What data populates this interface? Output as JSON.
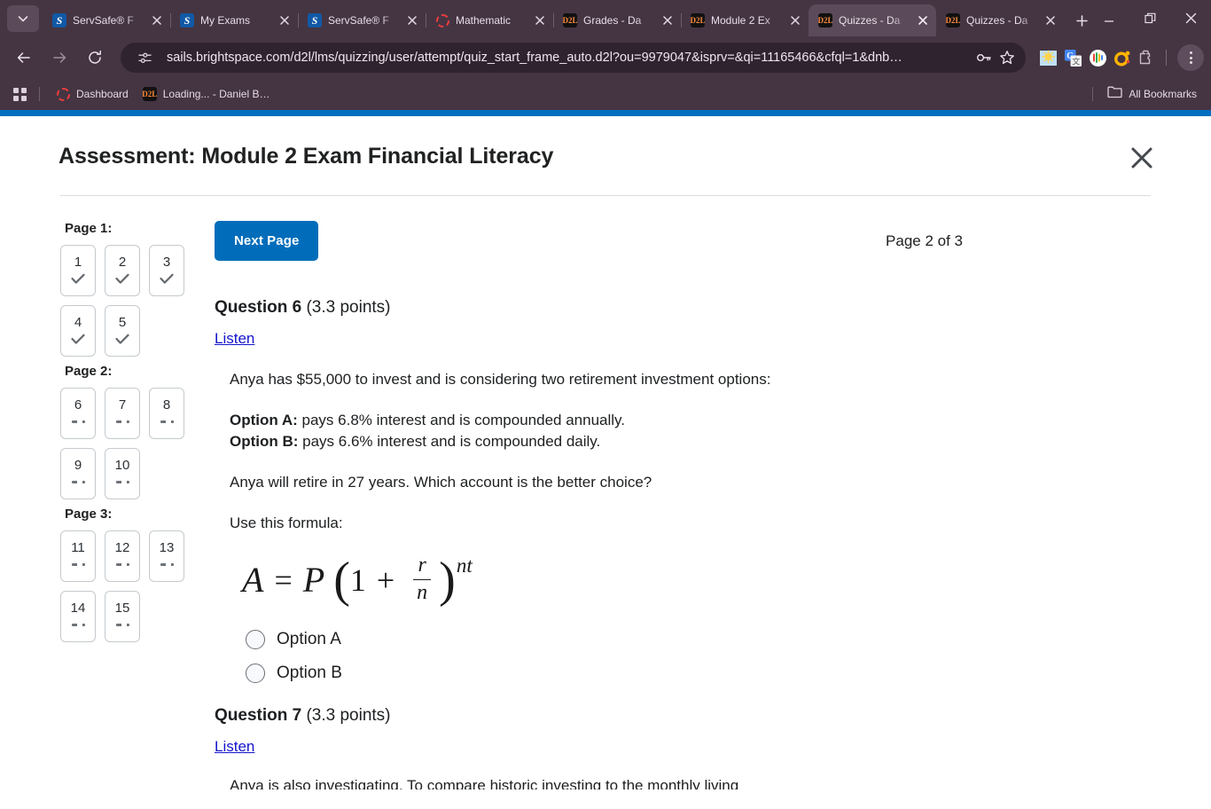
{
  "browser": {
    "tabs": [
      {
        "title": "ServSafe® F",
        "favicon": "servsafe-icon",
        "active": false
      },
      {
        "title": "My Exams",
        "favicon": "servsafe-icon",
        "active": false
      },
      {
        "title": "ServSafe® F",
        "favicon": "servsafe-icon",
        "active": false
      },
      {
        "title": "Mathematic",
        "favicon": "ring-icon",
        "active": false
      },
      {
        "title": "Grades - Da",
        "favicon": "d2l-icon",
        "active": false
      },
      {
        "title": "Module 2 Ex",
        "favicon": "d2l-icon",
        "active": false
      },
      {
        "title": "Quizzes - Da",
        "favicon": "d2l-icon",
        "active": true
      },
      {
        "title": "Quizzes - Da",
        "favicon": "d2l-icon",
        "active": false
      }
    ],
    "new_tab_label": "+",
    "window_controls": [
      "minimize-icon",
      "restore-icon",
      "close-icon"
    ],
    "nav": {
      "back": "back-arrow-icon",
      "forward": "forward-arrow-icon",
      "reload": "reload-icon"
    },
    "omnibox": {
      "site_info_icon": "site-settings-icon",
      "url": "sails.brightspace.com/d2l/lms/quizzing/user/attempt/quiz_start_frame_auto.d2l?ou=9979047&isprv=&qi=11165466&cfql=1&dnb…",
      "password_icon": "key-icon",
      "bookmark_icon": "star-icon"
    },
    "extensions": [
      "weather-extension-icon",
      "google-translate-icon",
      "colorful-circle-extension-icon",
      "orange-o-extension-icon",
      "puzzle-extensions-icon"
    ],
    "menu_icon": "kebab-menu-icon",
    "bookmarks": {
      "apps_icon": "apps-grid-icon",
      "items": [
        {
          "label": "Dashboard",
          "favicon": "ring-icon"
        },
        {
          "label": "Loading... - Daniel B…",
          "favicon": "d2l-icon"
        }
      ],
      "all_bookmarks_label": "All Bookmarks",
      "all_bookmarks_icon": "folder-icon"
    },
    "accent_color": "#006fbf",
    "chrome_color": "#453543"
  },
  "assessment": {
    "title": "Assessment: Module 2 Exam Financial Literacy",
    "close_icon": "close-icon",
    "navigator": {
      "groups": [
        {
          "label": "Page 1:",
          "questions": [
            {
              "num": "1",
              "state": "answered"
            },
            {
              "num": "2",
              "state": "answered"
            },
            {
              "num": "3",
              "state": "answered"
            },
            {
              "num": "4",
              "state": "answered"
            },
            {
              "num": "5",
              "state": "answered"
            }
          ]
        },
        {
          "label": "Page 2:",
          "questions": [
            {
              "num": "6",
              "state": "unanswered"
            },
            {
              "num": "7",
              "state": "unanswered"
            },
            {
              "num": "8",
              "state": "unanswered"
            },
            {
              "num": "9",
              "state": "unanswered"
            },
            {
              "num": "10",
              "state": "unanswered"
            }
          ]
        },
        {
          "label": "Page 3:",
          "questions": [
            {
              "num": "11",
              "state": "unanswered"
            },
            {
              "num": "12",
              "state": "unanswered"
            },
            {
              "num": "13",
              "state": "unanswered"
            },
            {
              "num": "14",
              "state": "unanswered"
            },
            {
              "num": "15",
              "state": "unanswered"
            }
          ]
        }
      ]
    },
    "toolbar": {
      "next_page_label": "Next Page",
      "page_indicator": "Page 2 of 3"
    },
    "questions": [
      {
        "heading_bold": "Question 6",
        "heading_points": " (3.3 points)",
        "listen_label": "Listen",
        "paragraphs": [
          "Anya has $55,000 to invest and is considering two retirement investment options:",
          "Anya will retire in 27 years. Which account is the better choice?",
          "Use this formula:"
        ],
        "option_a_label": "Option A:",
        "option_a_text": " pays 6.8% interest and is compounded annually.",
        "option_b_label": "Option B:",
        "option_b_text": " pays 6.6% interest and is compounded daily.",
        "formula": {
          "A": "A",
          "equals": "=",
          "P": "P",
          "open_paren": "(",
          "one": "1",
          "plus": "+",
          "numerator": "r",
          "denominator": "n",
          "close_paren": ")",
          "exponent": "nt",
          "plain": "A = P(1 + r/n)^nt"
        },
        "choices": [
          {
            "label": "Option A"
          },
          {
            "label": "Option B"
          }
        ]
      },
      {
        "heading_bold": "Question 7",
        "heading_points": " (3.3 points)",
        "listen_label": "Listen",
        "clipped_text": "Anya is also investigating. To compare historic investing to the monthly living"
      }
    ]
  }
}
